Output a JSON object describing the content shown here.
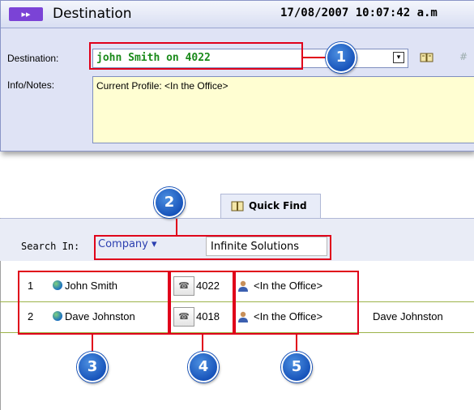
{
  "destination_panel": {
    "title": "Destination",
    "datetime": "17/08/2007 10:07:42 a.m",
    "destination_label": "Destination:",
    "destination_value": "john Smith on 4022",
    "info_label": "Info/Notes:",
    "info_value": "Current Profile: <In the Office>",
    "hash_symbol": "#"
  },
  "quick_find": {
    "tab_label": "Quick Find",
    "search_in_label": "Search In:",
    "search_in_selected": "Company ▾",
    "search_value": "Infinite Solutions",
    "rows": [
      {
        "index": "1",
        "name": "John Smith",
        "extension": "4022",
        "profile": "<In the Office>",
        "extra": ""
      },
      {
        "index": "2",
        "name": "Dave Johnston",
        "extension": "4018",
        "profile": "<In the Office>",
        "extra": "Dave Johnston"
      }
    ]
  },
  "callouts": [
    "1",
    "2",
    "3",
    "4",
    "5"
  ],
  "colors": {
    "callout_red": "#e0001a",
    "badge_blue": "#1450b8",
    "destination_text": "#1a8a1a",
    "notes_background": "#fffed2",
    "row_divider": "#9cb34a"
  },
  "icons": [
    "app-logo-icon",
    "dropdown-arrow-icon",
    "address-book-icon",
    "globe-icon",
    "phone-icon",
    "person-icon"
  ]
}
